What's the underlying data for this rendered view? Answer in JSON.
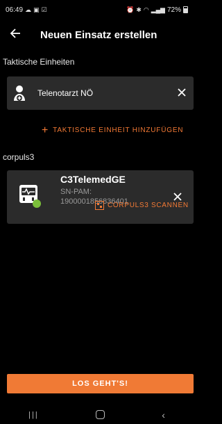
{
  "status_bar": {
    "time": "06:49",
    "battery": "72%"
  },
  "app_bar": {
    "back_icon": "arrow-left-icon",
    "title": "Neuen Einsatz erstellen"
  },
  "tactical_units": {
    "section_label": "Taktische Einheiten",
    "items": [
      {
        "label": "Telenotarzt NÖ",
        "icon": "doctor-icon"
      }
    ],
    "add_label": "TAKTISCHE EINHEIT HINZUFÜGEN"
  },
  "corpuls3": {
    "section_label": "corpuls3",
    "device": {
      "name": "C3TelemedGE",
      "sn_label": "SN-PAM:",
      "sn_value": "1900001856836401",
      "status_color": "#7bbf3a"
    },
    "scan_label": "CORPULS3 SCANNEN"
  },
  "primary_action": {
    "label": "LOS GEHT'S!"
  },
  "colors": {
    "accent": "#f07a35",
    "card_bg": "#2b2b2b",
    "background": "#000000"
  }
}
